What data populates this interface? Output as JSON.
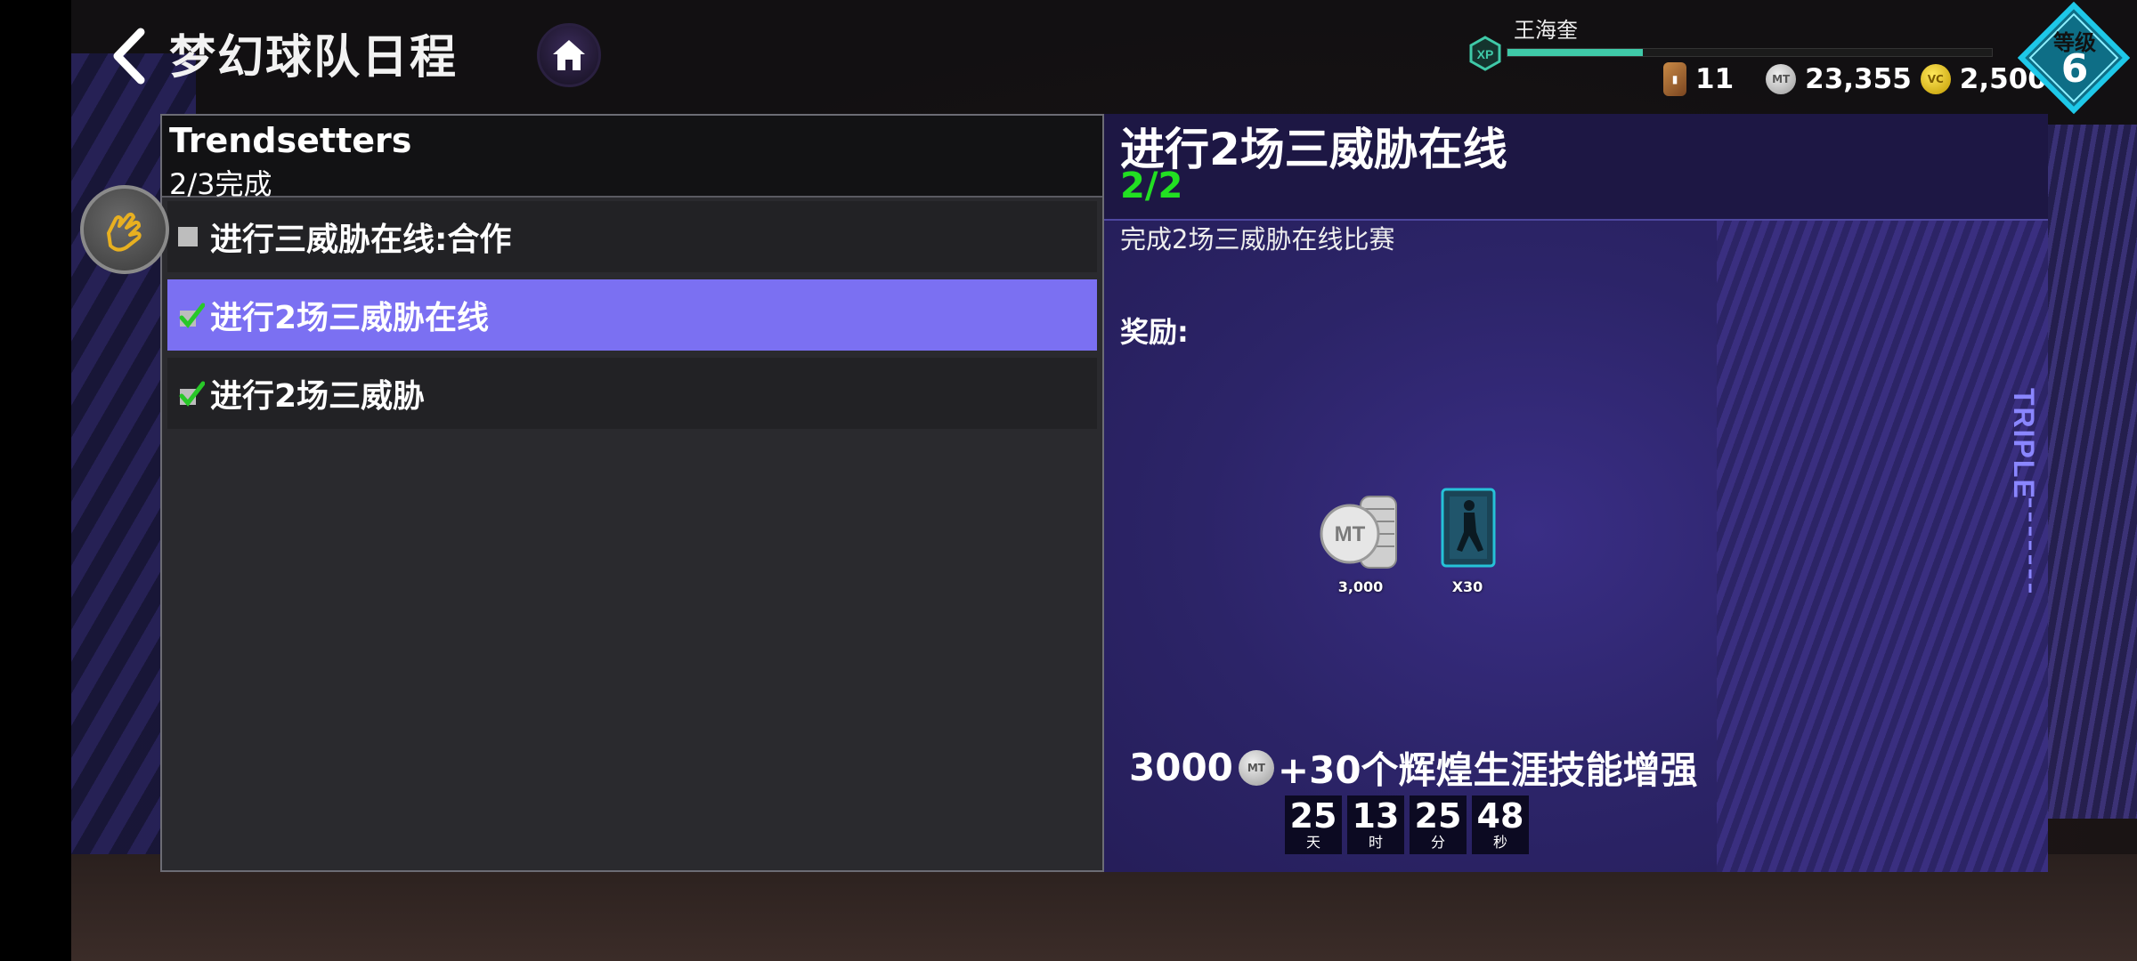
{
  "header": {
    "title": "梦幻球队日程",
    "player_name": "王海奎",
    "xp_badge": "XP",
    "xp_progress": 0.28,
    "currencies": {
      "cards": "11",
      "mt": "23,355",
      "vc": "2,500",
      "mt_icon_text": "MT",
      "vc_icon_text": "VC"
    },
    "level_label": "等级",
    "level_value": "6"
  },
  "task_set": {
    "title": "Trendsetters",
    "progress": "2/3完成",
    "tasks": [
      {
        "label": "进行三威胁在线:合作",
        "completed": false
      },
      {
        "label": "进行2场三威胁在线",
        "completed": true,
        "selected": true
      },
      {
        "label": "进行2场三威胁",
        "completed": true
      }
    ]
  },
  "detail": {
    "title": "进行2场三威胁在线",
    "progress": "2/2",
    "description": "完成2场三威胁在线比赛",
    "rewards_label": "奖励:",
    "rewards": [
      {
        "icon": "mt-coins-icon",
        "icon_text": "MT",
        "count": "3,000"
      },
      {
        "icon": "skill-boost-card-icon",
        "count": "X30"
      }
    ],
    "summary_left": "3000",
    "summary_right": "+30个辉煌生涯技能增强",
    "summary_coin_text": "MT",
    "countdown": [
      {
        "value": "25",
        "unit": "天"
      },
      {
        "value": "13",
        "unit": "时"
      },
      {
        "value": "25",
        "unit": "分"
      },
      {
        "value": "48",
        "unit": "秒"
      }
    ],
    "logo_text": "TRIPLE"
  },
  "colors": {
    "selected_row": "#7b70f2",
    "progress_green": "#22e022",
    "xp_fill": "#3fc9a8",
    "level_badge": "#1ec8e8"
  }
}
